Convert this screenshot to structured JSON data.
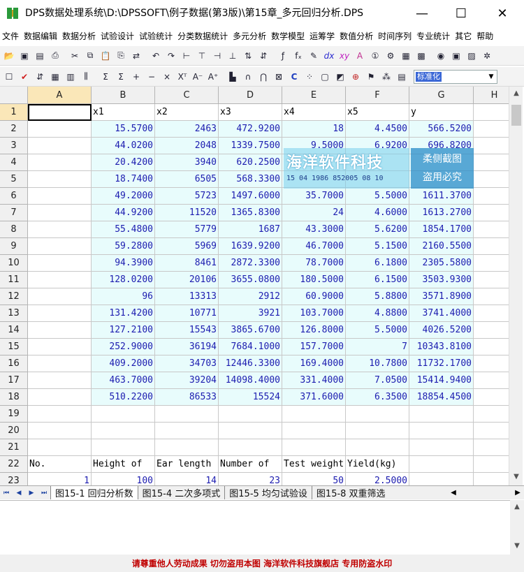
{
  "window": {
    "title": "DPS数据处理系统\\D:\\DPSSOFT\\例子数据(第3版)\\第15章_多元回归分析.DPS",
    "minimize": "—",
    "maximize": "☐",
    "close": "✕"
  },
  "menu": [
    "文件",
    "数据编辑",
    "数据分析",
    "试验设计",
    "试验统计",
    "分类数据统计",
    "多元分析",
    "数学模型",
    "运筹学",
    "数值分析",
    "时间序列",
    "专业统计",
    "其它",
    "帮助"
  ],
  "toolbar2_combo": "标准化",
  "grid": {
    "columns": [
      "A",
      "B",
      "C",
      "D",
      "E",
      "F",
      "G",
      "H"
    ],
    "active_cell": "A1",
    "rows": [
      {
        "n": "1",
        "cells": [
          "",
          "x1",
          "x2",
          "x3",
          "x4",
          "x5",
          "y"
        ]
      },
      {
        "n": "2",
        "cells": [
          "",
          "15.5700",
          "2463",
          "472.9200",
          "18",
          "4.4500",
          "566.5200"
        ]
      },
      {
        "n": "3",
        "cells": [
          "",
          "44.0200",
          "2048",
          "1339.7500",
          "9.5000",
          "6.9200",
          "696.8200"
        ]
      },
      {
        "n": "4",
        "cells": [
          "",
          "20.4200",
          "3940",
          "620.2500",
          "",
          "",
          ""
        ]
      },
      {
        "n": "5",
        "cells": [
          "",
          "18.7400",
          "6505",
          "568.3300",
          "",
          "",
          ""
        ]
      },
      {
        "n": "6",
        "cells": [
          "",
          "49.2000",
          "5723",
          "1497.6000",
          "35.7000",
          "5.5000",
          "1611.3700"
        ]
      },
      {
        "n": "7",
        "cells": [
          "",
          "44.9200",
          "11520",
          "1365.8300",
          "24",
          "4.6000",
          "1613.2700"
        ]
      },
      {
        "n": "8",
        "cells": [
          "",
          "55.4800",
          "5779",
          "1687",
          "43.3000",
          "5.6200",
          "1854.1700"
        ]
      },
      {
        "n": "9",
        "cells": [
          "",
          "59.2800",
          "5969",
          "1639.9200",
          "46.7000",
          "5.1500",
          "2160.5500"
        ]
      },
      {
        "n": "10",
        "cells": [
          "",
          "94.3900",
          "8461",
          "2872.3300",
          "78.7000",
          "6.1800",
          "2305.5800"
        ]
      },
      {
        "n": "11",
        "cells": [
          "",
          "128.0200",
          "20106",
          "3655.0800",
          "180.5000",
          "6.1500",
          "3503.9300"
        ]
      },
      {
        "n": "12",
        "cells": [
          "",
          "96",
          "13313",
          "2912",
          "60.9000",
          "5.8800",
          "3571.8900"
        ]
      },
      {
        "n": "13",
        "cells": [
          "",
          "131.4200",
          "10771",
          "3921",
          "103.7000",
          "4.8800",
          "3741.4000"
        ]
      },
      {
        "n": "14",
        "cells": [
          "",
          "127.2100",
          "15543",
          "3865.6700",
          "126.8000",
          "5.5000",
          "4026.5200"
        ]
      },
      {
        "n": "15",
        "cells": [
          "",
          "252.9000",
          "36194",
          "7684.1000",
          "157.7000",
          "7",
          "10343.8100"
        ]
      },
      {
        "n": "16",
        "cells": [
          "",
          "409.2000",
          "34703",
          "12446.3300",
          "169.4000",
          "10.7800",
          "11732.1700"
        ]
      },
      {
        "n": "17",
        "cells": [
          "",
          "463.7000",
          "39204",
          "14098.4000",
          "331.4000",
          "7.0500",
          "15414.9400"
        ]
      },
      {
        "n": "18",
        "cells": [
          "",
          "510.2200",
          "86533",
          "15524",
          "371.6000",
          "6.3500",
          "18854.4500"
        ]
      },
      {
        "n": "19",
        "cells": [
          "",
          "",
          "",
          "",
          "",
          "",
          ""
        ]
      },
      {
        "n": "20",
        "cells": [
          "",
          "",
          "",
          "",
          "",
          "",
          ""
        ]
      },
      {
        "n": "21",
        "cells": [
          "",
          "",
          "",
          "",
          "",
          "",
          ""
        ]
      },
      {
        "n": "22",
        "cells": [
          "No.",
          "Height of",
          "Ear length",
          "Number of",
          "Test weight",
          "Yield(kg)",
          ""
        ]
      },
      {
        "n": "23",
        "cells": [
          "1",
          "100",
          "14",
          "23",
          "50",
          "2.5000",
          ""
        ]
      }
    ]
  },
  "sheet_tabs": [
    "图15-1 回归分析数",
    "图15-4 二次多项式",
    "图15-5 均匀试验设",
    "图15-8 双重筛选"
  ],
  "status": "请尊重他人劳动成果   切勿盗用本图   海洋软件科技旗舰店   专用防盗水印",
  "watermark": {
    "main": "海洋软件科技",
    "code": "15 04 1986 852005 08 10",
    "right_line1": "柔侧截图",
    "right_line2": "盗用必究"
  }
}
